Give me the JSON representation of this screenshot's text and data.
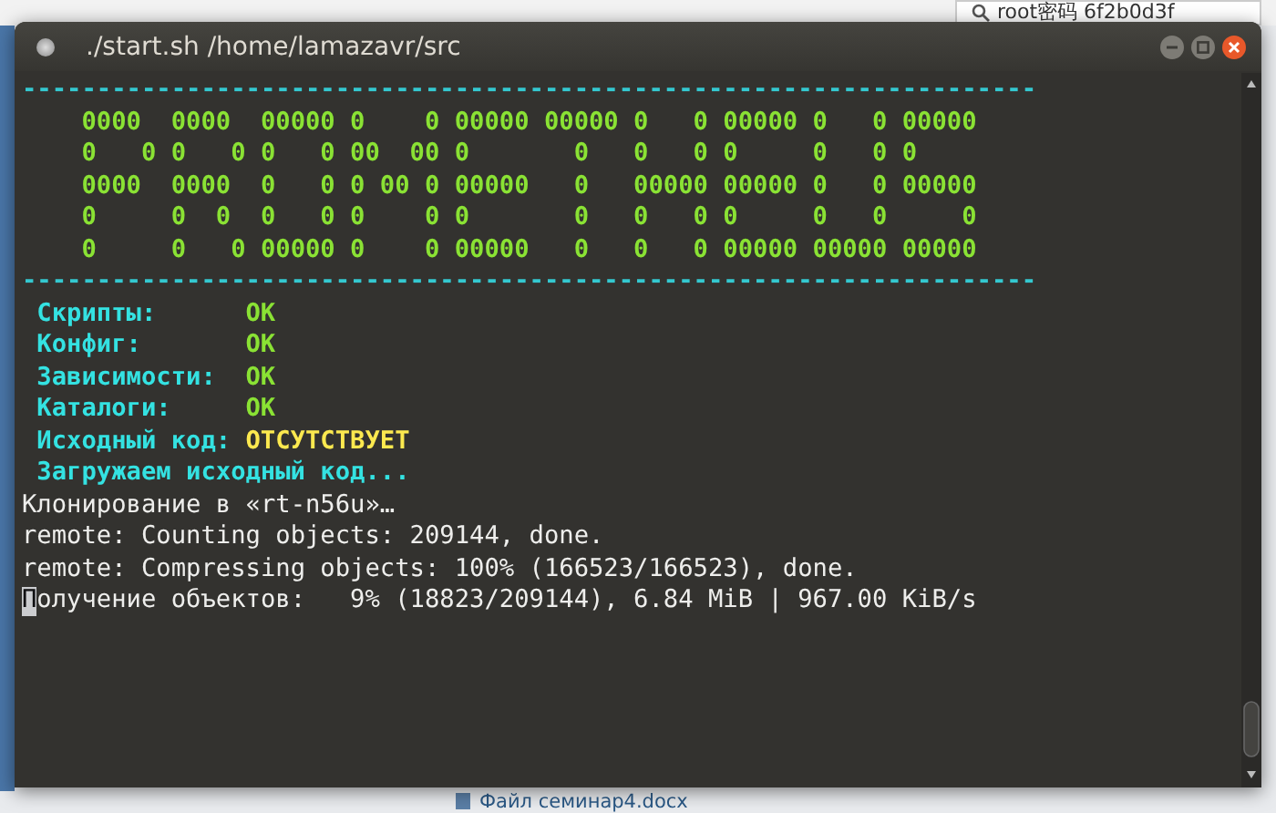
{
  "background": {
    "search_text": "root密码 6f2b0d3f",
    "file_link": "Файл семинар4.docx"
  },
  "terminal": {
    "title": "./start.sh /home/lamazavr/src",
    "lines": [
      {
        "kind": "rule",
        "text": "--------------------------------------------------------------------"
      },
      {
        "kind": "art",
        "text": "    0000  0000  00000 0    0 00000 00000 0   0 00000 0   0 00000"
      },
      {
        "kind": "art",
        "text": "    0   0 0   0 0   0 00  00 0       0   0   0 0     0   0 0"
      },
      {
        "kind": "art",
        "text": "    0000  0000  0   0 0 00 0 00000   0   00000 00000 0   0 00000"
      },
      {
        "kind": "art",
        "text": "    0     0  0  0   0 0    0 0       0   0   0 0     0   0     0"
      },
      {
        "kind": "art",
        "text": "    0     0   0 00000 0    0 00000   0   0   0 00000 00000 00000"
      },
      {
        "kind": "rule",
        "text": "--------------------------------------------------------------------"
      },
      {
        "kind": "status",
        "label": "Скрипты:",
        "value": "OK",
        "color": "#8ae234"
      },
      {
        "kind": "status",
        "label": "Конфиг:",
        "value": "OK",
        "color": "#8ae234"
      },
      {
        "kind": "status",
        "label": "Зависимости:",
        "value": "OK",
        "color": "#8ae234"
      },
      {
        "kind": "status",
        "label": "Каталоги:",
        "value": "OK",
        "color": "#8ae234"
      },
      {
        "kind": "status",
        "label": "Исходный код:",
        "value": "ОТСУТСТВУЕТ",
        "color": "#fce94f"
      },
      {
        "kind": "info",
        "text": "Загружаем исходный код..."
      },
      {
        "kind": "plain",
        "text": "Клонирование в «rt-n56u»…",
        "cursor": false
      },
      {
        "kind": "plain",
        "text": "remote: Counting objects: 209144, done.",
        "cursor": false
      },
      {
        "kind": "plain",
        "text": "remote: Compressing objects: 100% (166523/166523), done.",
        "cursor": false
      },
      {
        "kind": "plain",
        "text": "Получение объектов:   9% (18823/209144), 6.84 MiB | 967.00 KiB/s",
        "cursor": true
      }
    ]
  }
}
